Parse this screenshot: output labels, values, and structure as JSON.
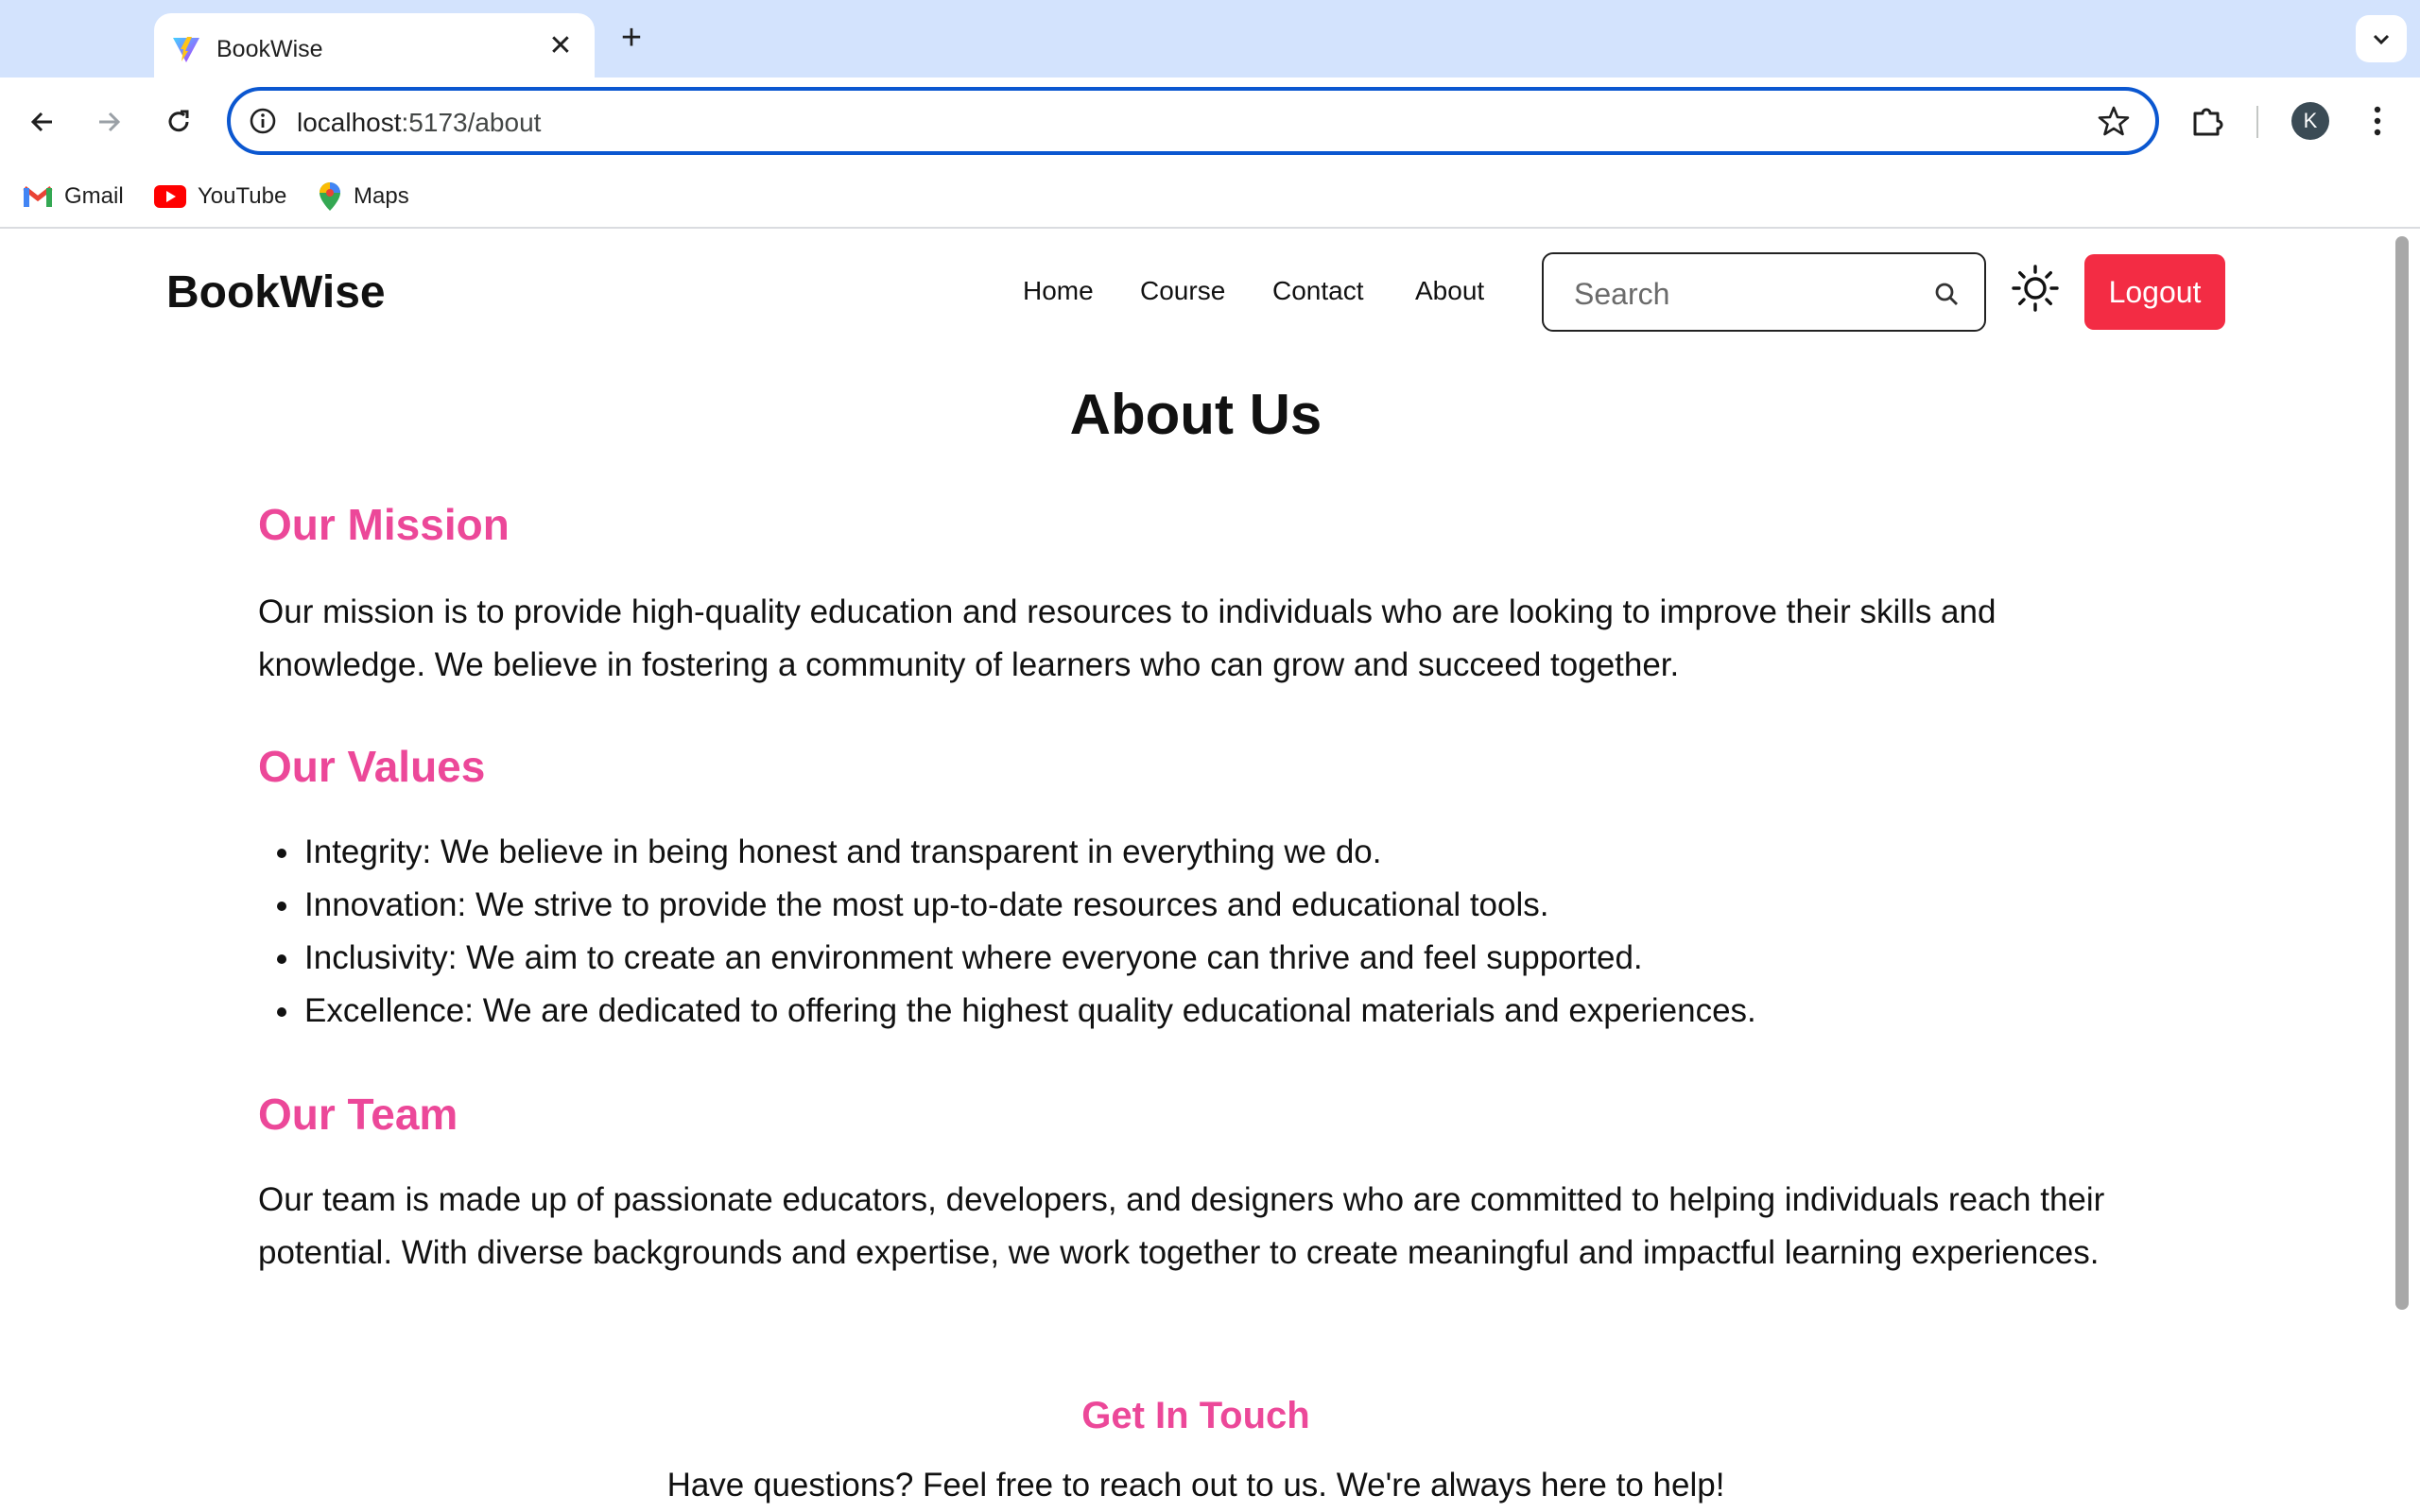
{
  "browser": {
    "tab_title": "BookWise",
    "url_host": "localhost",
    "url_path": ":5173/about",
    "avatar_letter": "K",
    "bookmarks": [
      {
        "label": "Gmail",
        "icon": "gmail-icon"
      },
      {
        "label": "YouTube",
        "icon": "youtube-icon"
      },
      {
        "label": "Maps",
        "icon": "maps-icon"
      }
    ]
  },
  "site": {
    "brand": "BookWise",
    "nav": [
      "Home",
      "Course",
      "Contact",
      "About"
    ],
    "search_placeholder": "Search",
    "logout_label": "Logout",
    "accent_color": "#ec4899",
    "logout_color": "#f32c44"
  },
  "content": {
    "title": "About Us",
    "mission_heading": "Our Mission",
    "mission_text": "Our mission is to provide high-quality education and resources to individuals who are looking to improve their skills and knowledge. We believe in fostering a community of learners who can grow and succeed together.",
    "values_heading": "Our Values",
    "values": [
      "Integrity: We believe in being honest and transparent in everything we do.",
      "Innovation: We strive to provide the most up-to-date resources and educational tools.",
      "Inclusivity: We aim to create an environment where everyone can thrive and feel supported.",
      "Excellence: We are dedicated to offering the highest quality educational materials and experiences."
    ],
    "team_heading": "Our Team",
    "team_text": "Our team is made up of passionate educators, developers, and designers who are committed to helping individuals reach their potential. With diverse backgrounds and expertise, we work together to create meaningful and impactful learning experiences.",
    "contact_heading": "Get In Touch",
    "contact_text": "Have questions? Feel free to reach out to us. We're always here to help!"
  }
}
